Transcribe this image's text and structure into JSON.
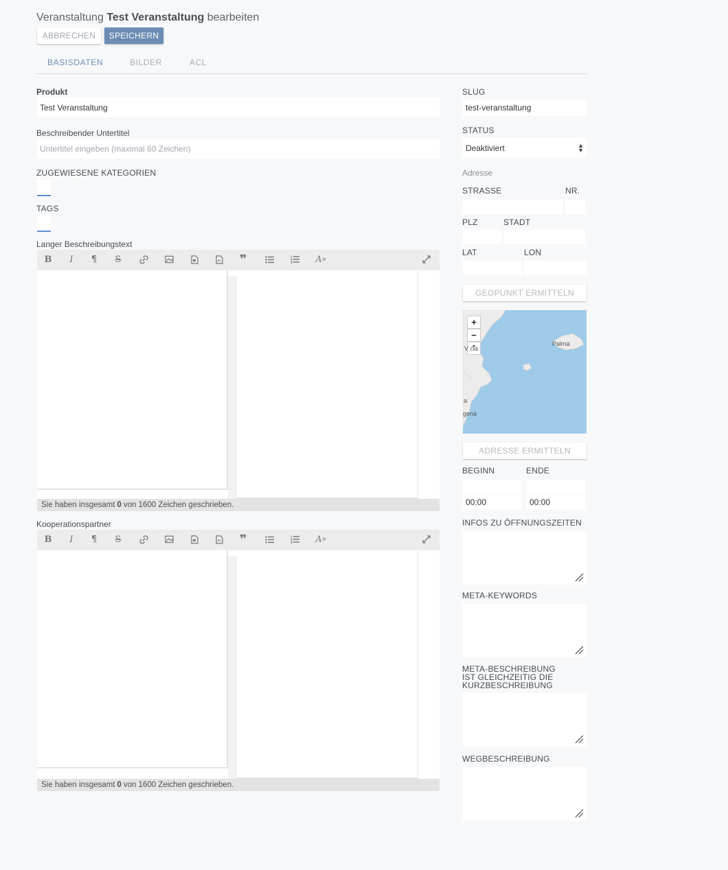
{
  "header": {
    "title_prefix": "Veranstaltung",
    "title_name": "Test Veranstaltung",
    "title_suffix": "bearbeiten",
    "cancel_label": "ABBRECHEN",
    "save_label": "SPEICHERN"
  },
  "tabs": [
    {
      "label": "BASISDATEN",
      "active": true
    },
    {
      "label": "BILDER",
      "active": false
    },
    {
      "label": "ACL",
      "active": false
    }
  ],
  "left": {
    "product_label": "Produkt",
    "product_value": "Test Veranstaltung",
    "subtitle_label": "Beschreibender Untertitel",
    "subtitle_placeholder": "Untertitel eingeben (maximal 60 Zeichen)",
    "categories_label": "ZUGEWIESENE KATEGORIEN",
    "tags_label": "TAGS",
    "long_text_label": "Langer Beschreibungstext",
    "partners_label": "Kooperationspartner",
    "counter_prefix": "Sie haben insgesamt",
    "counter_value": "0",
    "counter_suffix": "von 1600 Zeichen geschrieben."
  },
  "toolbar_icons": [
    "bold-icon",
    "italic-icon",
    "paragraph-icon",
    "strikethrough-icon",
    "link-icon",
    "image-icon",
    "video-icon",
    "pdf-icon",
    "quote-icon",
    "bullet-list-icon",
    "numbered-list-icon",
    "clear-format-icon",
    "fullscreen-icon"
  ],
  "right": {
    "slug_label": "SLUG",
    "slug_value": "test-veranstaltung",
    "status_label": "STATUS",
    "status_value": "Deaktiviert",
    "address_label": "Adresse",
    "street_label": "STRASSE",
    "nr_label": "NR.",
    "zip_label": "PLZ",
    "city_label": "STADT",
    "lat_label": "LAT",
    "lon_label": "LON",
    "geopoint_button": "GEOPUNKT ERMITTELN",
    "address_button": "ADRESSE ERMITTELN",
    "begin_label": "BEGINN",
    "end_label": "ENDE",
    "begin_time": "00:00",
    "end_time": "00:00",
    "opening_label": "INFOS ZU ÖFFNUNGSZEITEN",
    "keywords_label": "META-KEYWORDS",
    "meta_desc_line1": "META-BESCHREIBUNG",
    "meta_desc_line2": "IST GLEICHZEITIG DIE",
    "meta_desc_line3": "KURZBESCHREIBUNG",
    "directions_label": "WEGBESCHREIBUNG"
  },
  "map": {
    "zoom_in": "+",
    "zoom_out": "−",
    "compass": "⇡",
    "label_palma": "Palma",
    "label_valencia": "V  cia",
    "label_a": "a",
    "label_gena": "gena",
    "water_color": "#9ecbea",
    "land_color": "#ececec"
  },
  "colors": {
    "accent": "#6b8db4",
    "chip_underline": "#5b8fd6"
  }
}
